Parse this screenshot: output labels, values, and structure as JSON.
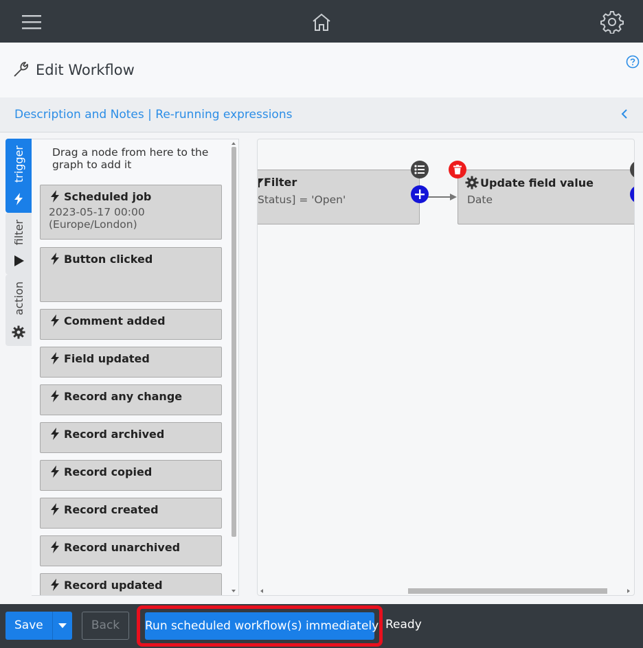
{
  "topbar": {
    "menu_icon": "hamburger-icon",
    "home_icon": "home-icon",
    "settings_icon": "gear-icon"
  },
  "header": {
    "title": "Edit Workflow",
    "title_icon": "wrench-icon",
    "help_icon": "help-circle-icon"
  },
  "linkbar": {
    "description_link": "Description and Notes",
    "separator": " | ",
    "rerun_link": "Re-running expressions",
    "collapse_glyph": "‹"
  },
  "tabs": [
    {
      "label": "trigger",
      "icon": "bolt-icon",
      "active": true
    },
    {
      "label": "filter",
      "icon": "play-icon",
      "active": false
    },
    {
      "label": "action",
      "icon": "gear-icon",
      "active": false
    }
  ],
  "palette": {
    "hint": "Drag a node from here to the graph to add it",
    "nodes": [
      {
        "title": "Scheduled job",
        "sub1": "2023-05-17 00:00",
        "sub2": "(Europe/London)"
      },
      {
        "title": "Button clicked"
      },
      {
        "title": "Comment added"
      },
      {
        "title": "Field updated"
      },
      {
        "title": "Record any change"
      },
      {
        "title": "Record archived"
      },
      {
        "title": "Record copied"
      },
      {
        "title": "Record created"
      },
      {
        "title": "Record unarchived"
      },
      {
        "title": "Record updated"
      }
    ]
  },
  "graph": {
    "filter_node": {
      "title": "Filter",
      "subtitle": "Status] = 'Open'"
    },
    "update_node": {
      "title": "Update field value",
      "subtitle": "Date"
    }
  },
  "footer": {
    "save_label": "Save",
    "back_label": "Back",
    "run_label": "Run scheduled workflow(s) immediately",
    "status": "Ready"
  },
  "colors": {
    "primary": "#1a7fe8",
    "dark_bar": "#343a40",
    "highlight": "#e8101e",
    "add_button": "#1414d8",
    "delete_button": "#ee1c1c"
  }
}
